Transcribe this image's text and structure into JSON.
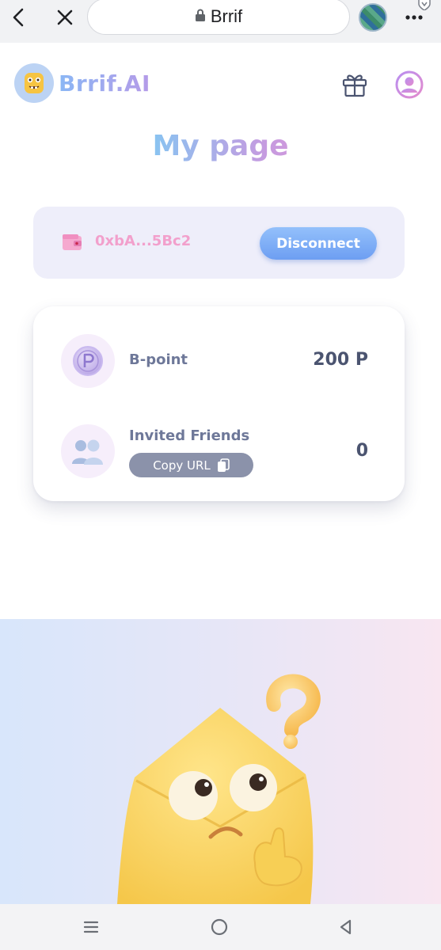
{
  "browser": {
    "url_text": "Brrif",
    "icons": [
      "back-arrow-icon",
      "close-icon",
      "lock-icon",
      "profile-avatar-icon",
      "more-vertical-icon"
    ]
  },
  "header": {
    "logo_text": "Brrif.AI",
    "icons": [
      "mascot-logo-icon",
      "gift-icon",
      "user-profile-icon"
    ]
  },
  "page": {
    "title": "My page"
  },
  "wallet": {
    "address": "0xbA...5Bc2",
    "disconnect_label": "Disconnect",
    "icon": "wallet-icon"
  },
  "stats": {
    "bpoint": {
      "label": "B-point",
      "value": "200 P",
      "icon": "coin-p-icon"
    },
    "friends": {
      "label": "Invited Friends",
      "value": "0",
      "copy_label": "Copy URL",
      "icon": "friends-icon"
    }
  },
  "illustration": {
    "subject": "mascot-question-icon"
  },
  "android_nav": {
    "icons": [
      "recent-apps-icon",
      "home-icon",
      "back-triangle-icon"
    ]
  },
  "colors": {
    "wallet_bg": "#eeeefa",
    "address": "#f2a0cc",
    "disconnect_bg": "#7faaf6",
    "copy_bg": "#8b92aa",
    "text_dark": "#4b5470",
    "text_label": "#6e7899"
  }
}
